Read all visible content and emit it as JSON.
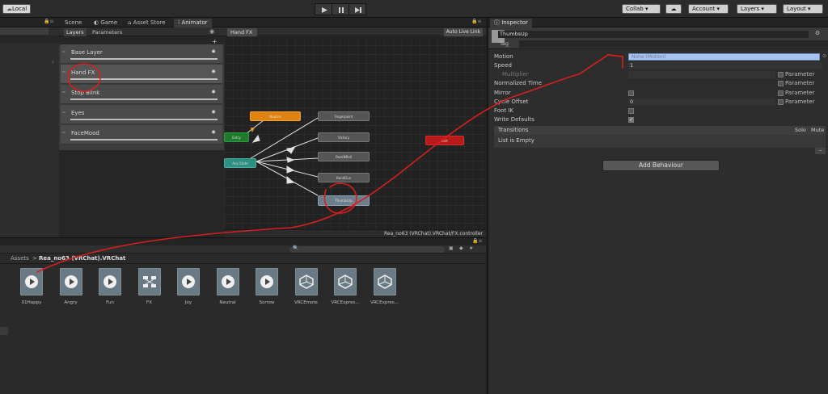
{
  "toolbar": {
    "account_label": "Local",
    "collab_label": "Collab ▾",
    "cloud_icon": "cloud-icon",
    "account_menu": "Account ▾",
    "layers_menu": "Layers ▾",
    "layout_menu": "Layout ▾"
  },
  "tabs": {
    "scene": "Scene",
    "game": "Game",
    "asset_store": "Asset Store",
    "animator": "Animator",
    "inspector": "Inspector"
  },
  "animator": {
    "subtabs": [
      "Layers",
      "Parameters"
    ],
    "breadcrumb": "Hand FX",
    "auto_live_link": "Auto Live Link",
    "layers": [
      {
        "name": "Base Layer"
      },
      {
        "name": "Hand FX"
      },
      {
        "name": "Stop Blink"
      },
      {
        "name": "Eyes"
      },
      {
        "name": "FaceMood"
      }
    ],
    "nodes": {
      "neutral": "Neutral",
      "entry": "Entry",
      "any_state": "Any State",
      "fingerpoint": "Fingerpoint",
      "victory": "Victory",
      "rocknroll": "RockNRoll",
      "handgun": "HandGun",
      "thumbsup": "ThumbsUp",
      "exit": "Exit"
    },
    "controller_path": "Rea_no63 (VRChat).VRChat/FX.controller"
  },
  "inspector": {
    "object_name": "ThumbsUp",
    "tag_label": "Tag",
    "motion_label": "Motion",
    "motion_value": "None (Motion)",
    "speed_label": "Speed",
    "speed_value": "1",
    "multiplier_label": "Multiplier",
    "normalized_time_label": "Normalized Time",
    "mirror_label": "Mirror",
    "cycle_offset_label": "Cycle Offset",
    "cycle_offset_value": "0",
    "foot_ik_label": "Foot IK",
    "write_defaults_label": "Write Defaults",
    "parameter_label": "Parameter",
    "transitions_label": "Transitions",
    "solo_label": "Solo",
    "mute_label": "Mute",
    "list_empty": "List is Empty",
    "add_behaviour": "Add Behaviour"
  },
  "project": {
    "breadcrumb_root": "Assets",
    "breadcrumb_sep": ">",
    "breadcrumb_folder": "Rea_no63 (VRChat).VRChat",
    "assets": [
      {
        "name": "01Happy",
        "type": "anim"
      },
      {
        "name": "Angry",
        "type": "anim"
      },
      {
        "name": "Fun",
        "type": "anim"
      },
      {
        "name": "FX",
        "type": "controller"
      },
      {
        "name": "Joy",
        "type": "anim"
      },
      {
        "name": "Neutral",
        "type": "anim"
      },
      {
        "name": "Sorrow",
        "type": "anim"
      },
      {
        "name": "VRCEmote",
        "type": "unity"
      },
      {
        "name": "VRCExpres...",
        "type": "unity"
      },
      {
        "name": "VRCExpres...",
        "type": "unity"
      }
    ]
  },
  "colors": {
    "annotation_red": "#d81e1e",
    "node_orange": "#e0820e",
    "node_green": "#1f7a2e",
    "node_teal": "#2f8f82",
    "node_red": "#b81a1a",
    "motion_field_blue": "#a8c4ee"
  }
}
